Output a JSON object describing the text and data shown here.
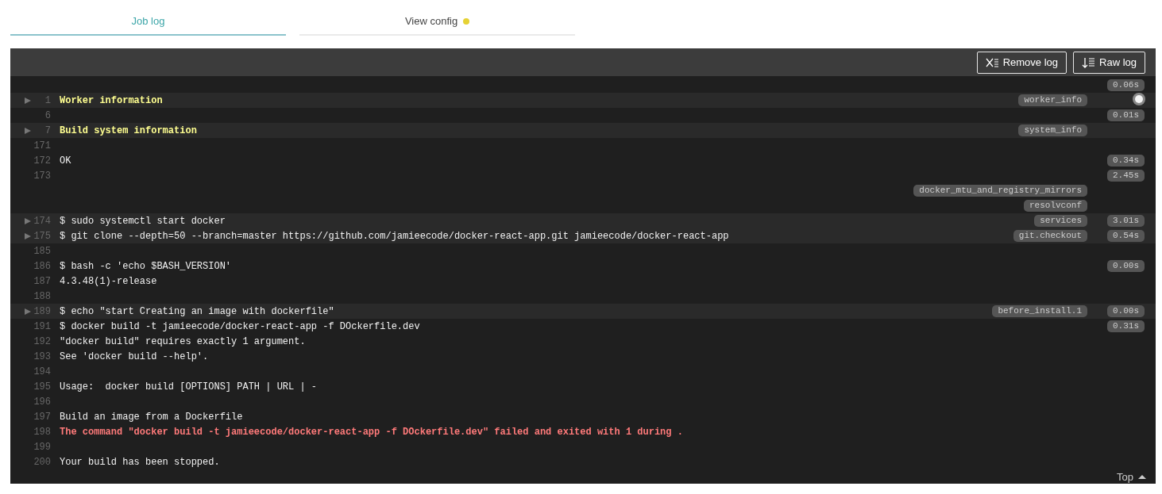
{
  "tabs": [
    {
      "label": "Job log",
      "selected": true
    },
    {
      "label": "View config",
      "selected": false,
      "color": "#e6d234"
    }
  ],
  "toolbar": {
    "buttons": [
      {
        "kind": "remove",
        "label": "Remove log"
      },
      {
        "kind": "raw",
        "label": "Raw log"
      }
    ]
  },
  "log": {
    "rows": [
      {
        "kind": "plain",
        "number": "",
        "text": "",
        "tag": "",
        "time": "0.06s"
      },
      {
        "kind": "header",
        "expanded": false,
        "number": "1",
        "text": "Worker information",
        "tag": "worker_info",
        "time": ""
      },
      {
        "kind": "plain",
        "number": "6",
        "text": "",
        "tag": "",
        "time": "0.01s"
      },
      {
        "kind": "header",
        "expanded": false,
        "number": "7",
        "text": "Build system information",
        "tag": "system_info",
        "time": ""
      },
      {
        "kind": "plain",
        "number": "171",
        "text": "",
        "tag": "",
        "time": ""
      },
      {
        "kind": "plain",
        "number": "172",
        "text": "OK",
        "tag": "",
        "time": "0.34s"
      },
      {
        "kind": "plain",
        "number": "173",
        "text": "",
        "tag": "",
        "time": "2.45s"
      },
      {
        "kind": "plain",
        "number": "",
        "text": "",
        "tag": "docker_mtu_and_registry_mirrors",
        "time": ""
      },
      {
        "kind": "plain",
        "number": "",
        "text": "",
        "tag": "resolvconf",
        "time": ""
      },
      {
        "kind": "plain",
        "expanded": false,
        "number": "174",
        "text": "$ sudo systemctl start docker",
        "tag": "services",
        "time": "3.01s"
      },
      {
        "kind": "plain",
        "expanded": false,
        "number": "175",
        "text": "$ git clone --depth=50 --branch=master https://github.com/jamieecode/docker-react-app.git jamieecode/docker-react-app",
        "tag": "git.checkout",
        "time": "0.54s"
      },
      {
        "kind": "plain",
        "number": "185",
        "text": "",
        "tag": "",
        "time": ""
      },
      {
        "kind": "plain",
        "number": "186",
        "text": "$ bash -c 'echo $BASH_VERSION'",
        "tag": "",
        "time": "0.00s"
      },
      {
        "kind": "plain",
        "number": "187",
        "text": "4.3.48(1)-release",
        "tag": "",
        "time": ""
      },
      {
        "kind": "plain",
        "number": "188",
        "text": "",
        "tag": "",
        "time": ""
      },
      {
        "kind": "plain",
        "expanded": false,
        "number": "189",
        "text": "$ echo \"start Creating an image with dockerfile\"",
        "tag": "before_install.1",
        "time": "0.00s"
      },
      {
        "kind": "plain",
        "number": "191",
        "text": "$ docker build -t jamieecode/docker-react-app -f DOckerfile.dev",
        "tag": "",
        "time": "0.31s"
      },
      {
        "kind": "plain",
        "number": "192",
        "text": "\"docker build\" requires exactly 1 argument.",
        "tag": "",
        "time": ""
      },
      {
        "kind": "plain",
        "number": "193",
        "text": "See 'docker build --help'.",
        "tag": "",
        "time": ""
      },
      {
        "kind": "plain",
        "number": "194",
        "text": "",
        "tag": "",
        "time": ""
      },
      {
        "kind": "plain",
        "number": "195",
        "text": "Usage:  docker build [OPTIONS] PATH | URL | -",
        "tag": "",
        "time": ""
      },
      {
        "kind": "plain",
        "number": "196",
        "text": "",
        "tag": "",
        "time": ""
      },
      {
        "kind": "plain",
        "number": "197",
        "text": "Build an image from a Dockerfile",
        "tag": "",
        "time": ""
      },
      {
        "kind": "error",
        "number": "198",
        "text": "The command \"docker build -t jamieecode/docker-react-app -f DOckerfile.dev\" failed and exited with 1 during .",
        "tag": "",
        "time": ""
      },
      {
        "kind": "plain",
        "number": "199",
        "text": "",
        "tag": "",
        "time": ""
      },
      {
        "kind": "plain",
        "number": "200",
        "text": "Your build has been stopped.",
        "tag": "",
        "time": ""
      }
    ]
  },
  "top_link": {
    "label": "Top"
  }
}
